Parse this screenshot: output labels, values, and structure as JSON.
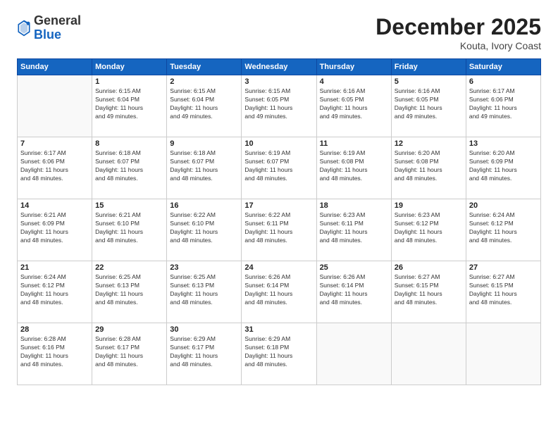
{
  "header": {
    "logo_general": "General",
    "logo_blue": "Blue",
    "month_title": "December 2025",
    "location": "Kouta, Ivory Coast"
  },
  "days_of_week": [
    "Sunday",
    "Monday",
    "Tuesday",
    "Wednesday",
    "Thursday",
    "Friday",
    "Saturday"
  ],
  "weeks": [
    [
      {
        "day": "",
        "info": ""
      },
      {
        "day": "1",
        "info": "Sunrise: 6:15 AM\nSunset: 6:04 PM\nDaylight: 11 hours\nand 49 minutes."
      },
      {
        "day": "2",
        "info": "Sunrise: 6:15 AM\nSunset: 6:04 PM\nDaylight: 11 hours\nand 49 minutes."
      },
      {
        "day": "3",
        "info": "Sunrise: 6:15 AM\nSunset: 6:05 PM\nDaylight: 11 hours\nand 49 minutes."
      },
      {
        "day": "4",
        "info": "Sunrise: 6:16 AM\nSunset: 6:05 PM\nDaylight: 11 hours\nand 49 minutes."
      },
      {
        "day": "5",
        "info": "Sunrise: 6:16 AM\nSunset: 6:05 PM\nDaylight: 11 hours\nand 49 minutes."
      },
      {
        "day": "6",
        "info": "Sunrise: 6:17 AM\nSunset: 6:06 PM\nDaylight: 11 hours\nand 49 minutes."
      }
    ],
    [
      {
        "day": "7",
        "info": "Sunrise: 6:17 AM\nSunset: 6:06 PM\nDaylight: 11 hours\nand 48 minutes."
      },
      {
        "day": "8",
        "info": "Sunrise: 6:18 AM\nSunset: 6:07 PM\nDaylight: 11 hours\nand 48 minutes."
      },
      {
        "day": "9",
        "info": "Sunrise: 6:18 AM\nSunset: 6:07 PM\nDaylight: 11 hours\nand 48 minutes."
      },
      {
        "day": "10",
        "info": "Sunrise: 6:19 AM\nSunset: 6:07 PM\nDaylight: 11 hours\nand 48 minutes."
      },
      {
        "day": "11",
        "info": "Sunrise: 6:19 AM\nSunset: 6:08 PM\nDaylight: 11 hours\nand 48 minutes."
      },
      {
        "day": "12",
        "info": "Sunrise: 6:20 AM\nSunset: 6:08 PM\nDaylight: 11 hours\nand 48 minutes."
      },
      {
        "day": "13",
        "info": "Sunrise: 6:20 AM\nSunset: 6:09 PM\nDaylight: 11 hours\nand 48 minutes."
      }
    ],
    [
      {
        "day": "14",
        "info": "Sunrise: 6:21 AM\nSunset: 6:09 PM\nDaylight: 11 hours\nand 48 minutes."
      },
      {
        "day": "15",
        "info": "Sunrise: 6:21 AM\nSunset: 6:10 PM\nDaylight: 11 hours\nand 48 minutes."
      },
      {
        "day": "16",
        "info": "Sunrise: 6:22 AM\nSunset: 6:10 PM\nDaylight: 11 hours\nand 48 minutes."
      },
      {
        "day": "17",
        "info": "Sunrise: 6:22 AM\nSunset: 6:11 PM\nDaylight: 11 hours\nand 48 minutes."
      },
      {
        "day": "18",
        "info": "Sunrise: 6:23 AM\nSunset: 6:11 PM\nDaylight: 11 hours\nand 48 minutes."
      },
      {
        "day": "19",
        "info": "Sunrise: 6:23 AM\nSunset: 6:12 PM\nDaylight: 11 hours\nand 48 minutes."
      },
      {
        "day": "20",
        "info": "Sunrise: 6:24 AM\nSunset: 6:12 PM\nDaylight: 11 hours\nand 48 minutes."
      }
    ],
    [
      {
        "day": "21",
        "info": "Sunrise: 6:24 AM\nSunset: 6:12 PM\nDaylight: 11 hours\nand 48 minutes."
      },
      {
        "day": "22",
        "info": "Sunrise: 6:25 AM\nSunset: 6:13 PM\nDaylight: 11 hours\nand 48 minutes."
      },
      {
        "day": "23",
        "info": "Sunrise: 6:25 AM\nSunset: 6:13 PM\nDaylight: 11 hours\nand 48 minutes."
      },
      {
        "day": "24",
        "info": "Sunrise: 6:26 AM\nSunset: 6:14 PM\nDaylight: 11 hours\nand 48 minutes."
      },
      {
        "day": "25",
        "info": "Sunrise: 6:26 AM\nSunset: 6:14 PM\nDaylight: 11 hours\nand 48 minutes."
      },
      {
        "day": "26",
        "info": "Sunrise: 6:27 AM\nSunset: 6:15 PM\nDaylight: 11 hours\nand 48 minutes."
      },
      {
        "day": "27",
        "info": "Sunrise: 6:27 AM\nSunset: 6:15 PM\nDaylight: 11 hours\nand 48 minutes."
      }
    ],
    [
      {
        "day": "28",
        "info": "Sunrise: 6:28 AM\nSunset: 6:16 PM\nDaylight: 11 hours\nand 48 minutes."
      },
      {
        "day": "29",
        "info": "Sunrise: 6:28 AM\nSunset: 6:17 PM\nDaylight: 11 hours\nand 48 minutes."
      },
      {
        "day": "30",
        "info": "Sunrise: 6:29 AM\nSunset: 6:17 PM\nDaylight: 11 hours\nand 48 minutes."
      },
      {
        "day": "31",
        "info": "Sunrise: 6:29 AM\nSunset: 6:18 PM\nDaylight: 11 hours\nand 48 minutes."
      },
      {
        "day": "",
        "info": ""
      },
      {
        "day": "",
        "info": ""
      },
      {
        "day": "",
        "info": ""
      }
    ]
  ]
}
